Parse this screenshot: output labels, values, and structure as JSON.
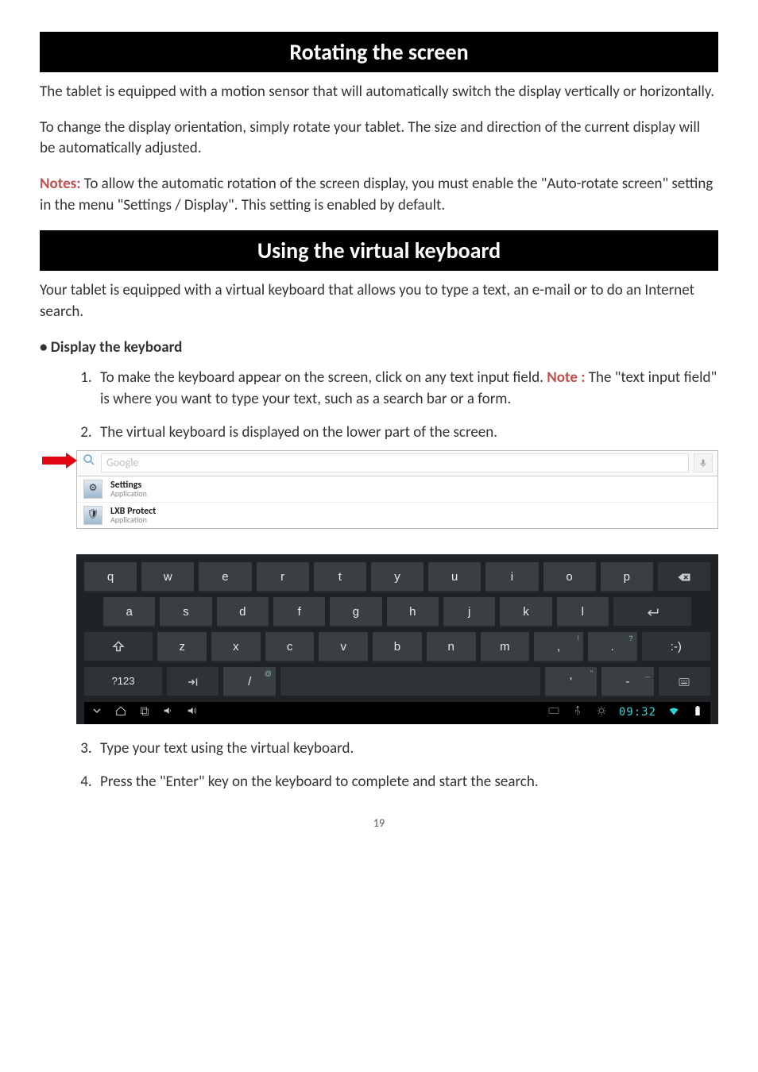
{
  "banners": {
    "rotate": "Rotating the screen",
    "vk": "Using the virtual keyboard"
  },
  "rotate": {
    "p1": "The tablet is equipped with a motion sensor that will automatically switch the display vertically or horizontally.",
    "p2": "To change the display orientation, simply rotate your tablet. The size and direction of the current display will be automatically adjusted.",
    "notes_label": "Notes:",
    "notes_body": " To allow the automatic rotation of the screen display, you must enable the \"Auto-rotate screen\" setting in the menu \"Settings / Display\". This setting is enabled by default."
  },
  "vk": {
    "intro": "Your tablet is equipped with a virtual keyboard that allows you to type a text, an e-mail or to do an Internet search.",
    "bullet_heading": "• Display the keyboard",
    "step1a": "To make the keyboard appear on the screen, click on any text input field. ",
    "step1_note_label": "Note :",
    "step1b": " The \"text input field\" is where you want to type your text, such as a search bar or a form.",
    "step2": "The virtual keyboard is displayed on the lower part of the screen.",
    "step3": "Type your text using the virtual keyboard.",
    "step4": "Press the \"Enter\" key on the keyboard to complete and start the search."
  },
  "screenshot": {
    "search_placeholder": "Google",
    "results": [
      {
        "title": "Settings",
        "sub": "Application"
      },
      {
        "title": "LXB Protect",
        "sub": "Application"
      }
    ],
    "keys": {
      "row1": [
        "q",
        "w",
        "e",
        "r",
        "t",
        "y",
        "u",
        "i",
        "o",
        "p"
      ],
      "row2": [
        "a",
        "s",
        "d",
        "f",
        "g",
        "h",
        "j",
        "k",
        "l"
      ],
      "row3_mid": [
        "z",
        "x",
        "c",
        "v",
        "b",
        "n",
        "m"
      ],
      "punct": [
        ",",
        "."
      ],
      "smile": ":-)",
      "numtoggle": "?123",
      "slash": "/",
      "slash_sup": "@",
      "apos": "'",
      "apos_sup": "\"",
      "dash": "-",
      "dash_sup": "_",
      "comma_sup": "!",
      "period_sup": "?"
    },
    "sysbar": {
      "clock": "09:32"
    }
  },
  "page_num": "19"
}
